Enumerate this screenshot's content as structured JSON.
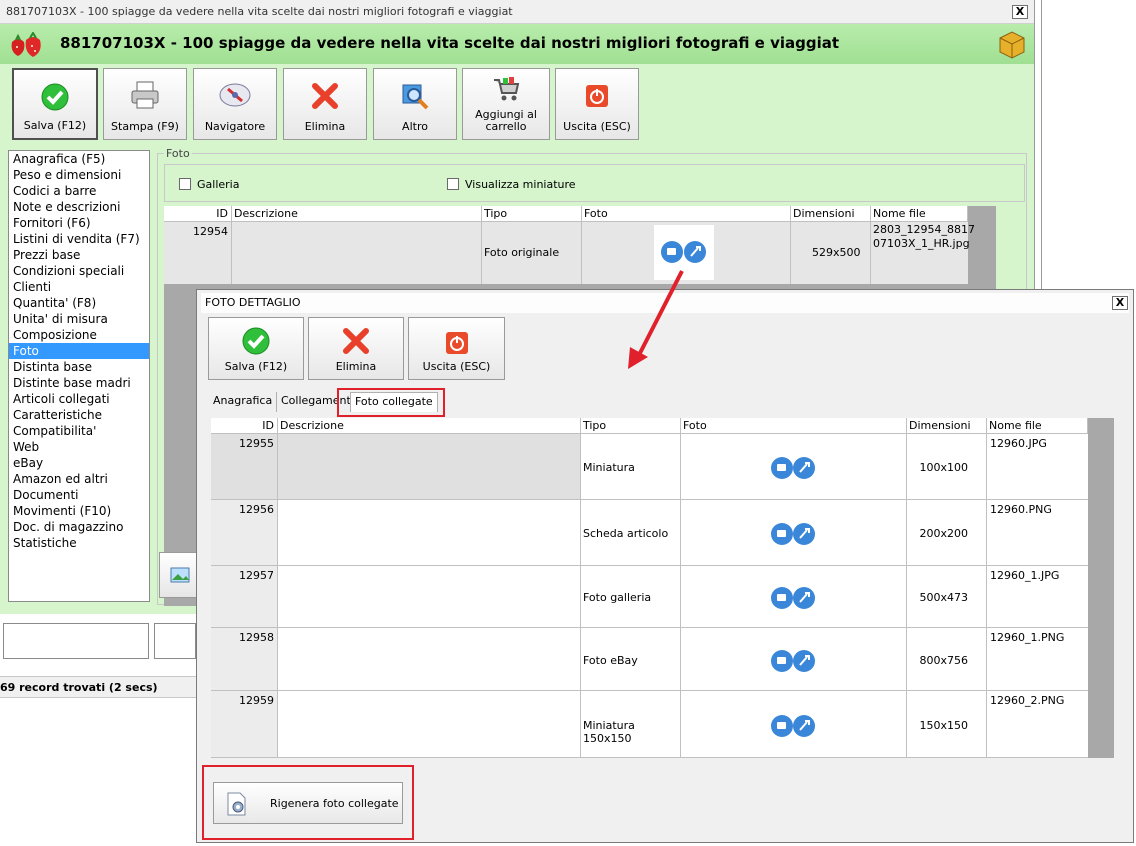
{
  "main": {
    "titlebar_text": "881707103X - 100 spiagge da vedere nella vita scelte dai nostri migliori fotografi e viaggiat",
    "header_title": "881707103X - 100 spiagge da vedere nella vita scelte dai nostri migliori fotografi e viaggiat",
    "close_label": "X",
    "toolbar": {
      "save": "Salva (F12)",
      "print": "Stampa (F9)",
      "navigator": "Navigatore",
      "delete": "Elimina",
      "other": "Altro",
      "cart_line1": "Aggiungi al",
      "cart_line2": "carrello",
      "exit": "Uscita (ESC)"
    },
    "nav_items": [
      "Anagrafica (F5)",
      "Peso e dimensioni",
      "Codici a barre",
      "Note e descrizioni",
      "Fornitori (F6)",
      "Listini di vendita (F7)",
      "Prezzi base",
      "Condizioni speciali",
      "Clienti",
      "Quantita' (F8)",
      "Unita' di misura",
      "Composizione",
      "Foto",
      "Distinta base",
      "Distinte base madri",
      "Articoli collegati",
      "Caratteristiche",
      "Compatibilita'",
      "Web",
      "eBay",
      "Amazon ed altri",
      "Documenti",
      "Movimenti (F10)",
      "Doc. di magazzino",
      "Statistiche"
    ],
    "selected_nav": "Foto",
    "foto_group_label": "Foto",
    "chk_gallery": "Galleria",
    "chk_thumbs": "Visualizza miniature",
    "grid_headers": {
      "id": "ID",
      "desc": "Descrizione",
      "type": "Tipo",
      "photo": "Foto",
      "dims": "Dimensioni",
      "file": "Nome file"
    },
    "grid_row": {
      "id": "12954",
      "desc": "",
      "type": "Foto originale",
      "dims": "529x500",
      "file_line1": "2803_12954_8817",
      "file_line2": "07103X_1_HR.jpg"
    },
    "status": "69 record trovati (2 secs)"
  },
  "detail": {
    "title": "FOTO DETTAGLIO",
    "close_label": "X",
    "toolbar": {
      "save": "Salva (F12)",
      "delete": "Elimina",
      "exit": "Uscita (ESC)"
    },
    "tabs": [
      "Anagrafica",
      "Collegamenti",
      "Foto collegate"
    ],
    "active_tab": "Foto collegate",
    "grid_headers": {
      "id": "ID",
      "desc": "Descrizione",
      "type": "Tipo",
      "photo": "Foto",
      "dims": "Dimensioni",
      "file": "Nome file"
    },
    "rows": [
      {
        "id": "12955",
        "desc": "",
        "type": "Miniatura",
        "dims": "100x100",
        "file": "12960.JPG"
      },
      {
        "id": "12956",
        "desc": "",
        "type": "Scheda articolo",
        "dims": "200x200",
        "file": "12960.PNG"
      },
      {
        "id": "12957",
        "desc": "",
        "type": "Foto galleria",
        "dims": "500x473",
        "file": "12960_1.JPG"
      },
      {
        "id": "12958",
        "desc": "",
        "type": "Foto eBay",
        "dims": "800x756",
        "file": "12960_1.PNG"
      },
      {
        "id": "12959",
        "desc": "",
        "type": "Miniatura 150x150",
        "dims": "150x150",
        "file": "12960_2.PNG"
      }
    ],
    "regen_button": "Rigenera foto collegate"
  },
  "colors": {
    "main_bg": "#d6f5cd",
    "header_green": "#a8e49a",
    "highlight_red": "#e0202a",
    "selection_blue": "#3399ff",
    "photo_icon_blue": "#3a87d9"
  }
}
